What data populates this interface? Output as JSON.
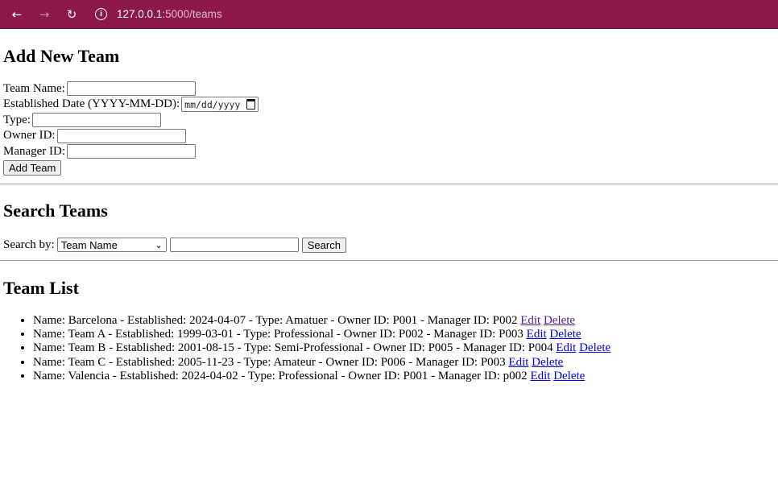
{
  "browser": {
    "url_host": "127.0.0.1",
    "url_rest": ":5000/teams"
  },
  "add_team": {
    "heading": "Add New Team",
    "team_name_label": "Team Name:",
    "established_label": "Established Date (YYYY-MM-DD):",
    "established_placeholder": "mm/dd/yyyy",
    "type_label": "Type:",
    "owner_label": "Owner ID:",
    "manager_label": "Manager ID:",
    "submit_label": "Add Team"
  },
  "search": {
    "heading": "Search Teams",
    "by_label": "Search by:",
    "selected_option": "Team Name",
    "button_label": "Search"
  },
  "team_list": {
    "heading": "Team List",
    "edit_label": "Edit",
    "delete_label": "Delete",
    "items": [
      "Name: Barcelona - Established: 2024-04-07 - Type: Amatuer - Owner ID: P001 - Manager ID: P002",
      "Name: Team A - Established: 1999-03-01 - Type: Professional - Owner ID: P002 - Manager ID: P003",
      "Name: Team B - Established: 2001-08-15 - Type: Semi-Professional - Owner ID: P005 - Manager ID: P004",
      "Name: Team C - Established: 2005-11-23 - Type: Amateur - Owner ID: P006 - Manager ID: P003",
      "Name: Valencia - Established: 2024-04-02 - Type: Professional - Owner ID: P001 - Manager ID: p002"
    ]
  },
  "colors": {
    "browser_bar": "#8b1848",
    "link": "#0000ee",
    "visited_link": "#551a8b"
  }
}
